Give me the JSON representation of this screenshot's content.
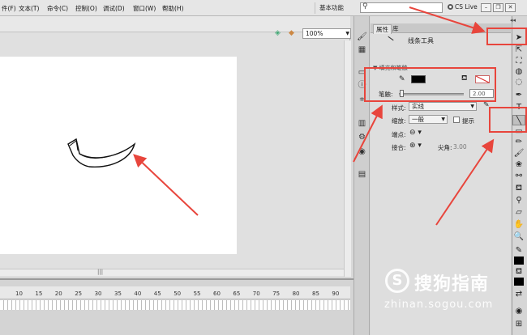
{
  "menubar": {
    "items": [
      "件(F)",
      "文本(T)",
      "命令(C)",
      "控制(O)",
      "调试(D)",
      "窗口(W)",
      "帮助(H)"
    ],
    "workspace": "基本功能",
    "cs_live": "CS Live"
  },
  "stage": {
    "zoom": "100%"
  },
  "timeline": {
    "frame_labels": [
      "10",
      "15",
      "20",
      "25",
      "30",
      "35",
      "40",
      "45",
      "50",
      "55",
      "60",
      "65",
      "70",
      "75",
      "80",
      "85",
      "90"
    ]
  },
  "properties": {
    "tabs": [
      "属性",
      "库"
    ],
    "tool_name": "线条工具",
    "section_header": "填充和笔触",
    "stroke_label": "笔触",
    "stroke_value": "2.00",
    "style_label": "样式",
    "style_value": "实线",
    "scale_label": "缩放",
    "scale_value": "一般",
    "hint_label": "提示",
    "cap_label": "端点",
    "join_label": "接合",
    "miter_label": "尖角",
    "miter_value": "3.00"
  },
  "colors": {
    "stroke": "#000000",
    "annotation": "#e8453c"
  },
  "icons": [
    "search-icon",
    "selection-icon",
    "subselection-icon",
    "free-transform-icon",
    "lasso-icon",
    "pen-icon",
    "text-icon",
    "line-icon",
    "rectangle-icon",
    "pencil-icon",
    "brush-icon",
    "bone-icon",
    "paint-bucket-icon",
    "eyedropper-icon",
    "eraser-icon",
    "hand-icon",
    "zoom-icon"
  ],
  "watermark": {
    "logo": "S",
    "title": "搜狗指南",
    "url": "zhinan.sogou.com"
  }
}
